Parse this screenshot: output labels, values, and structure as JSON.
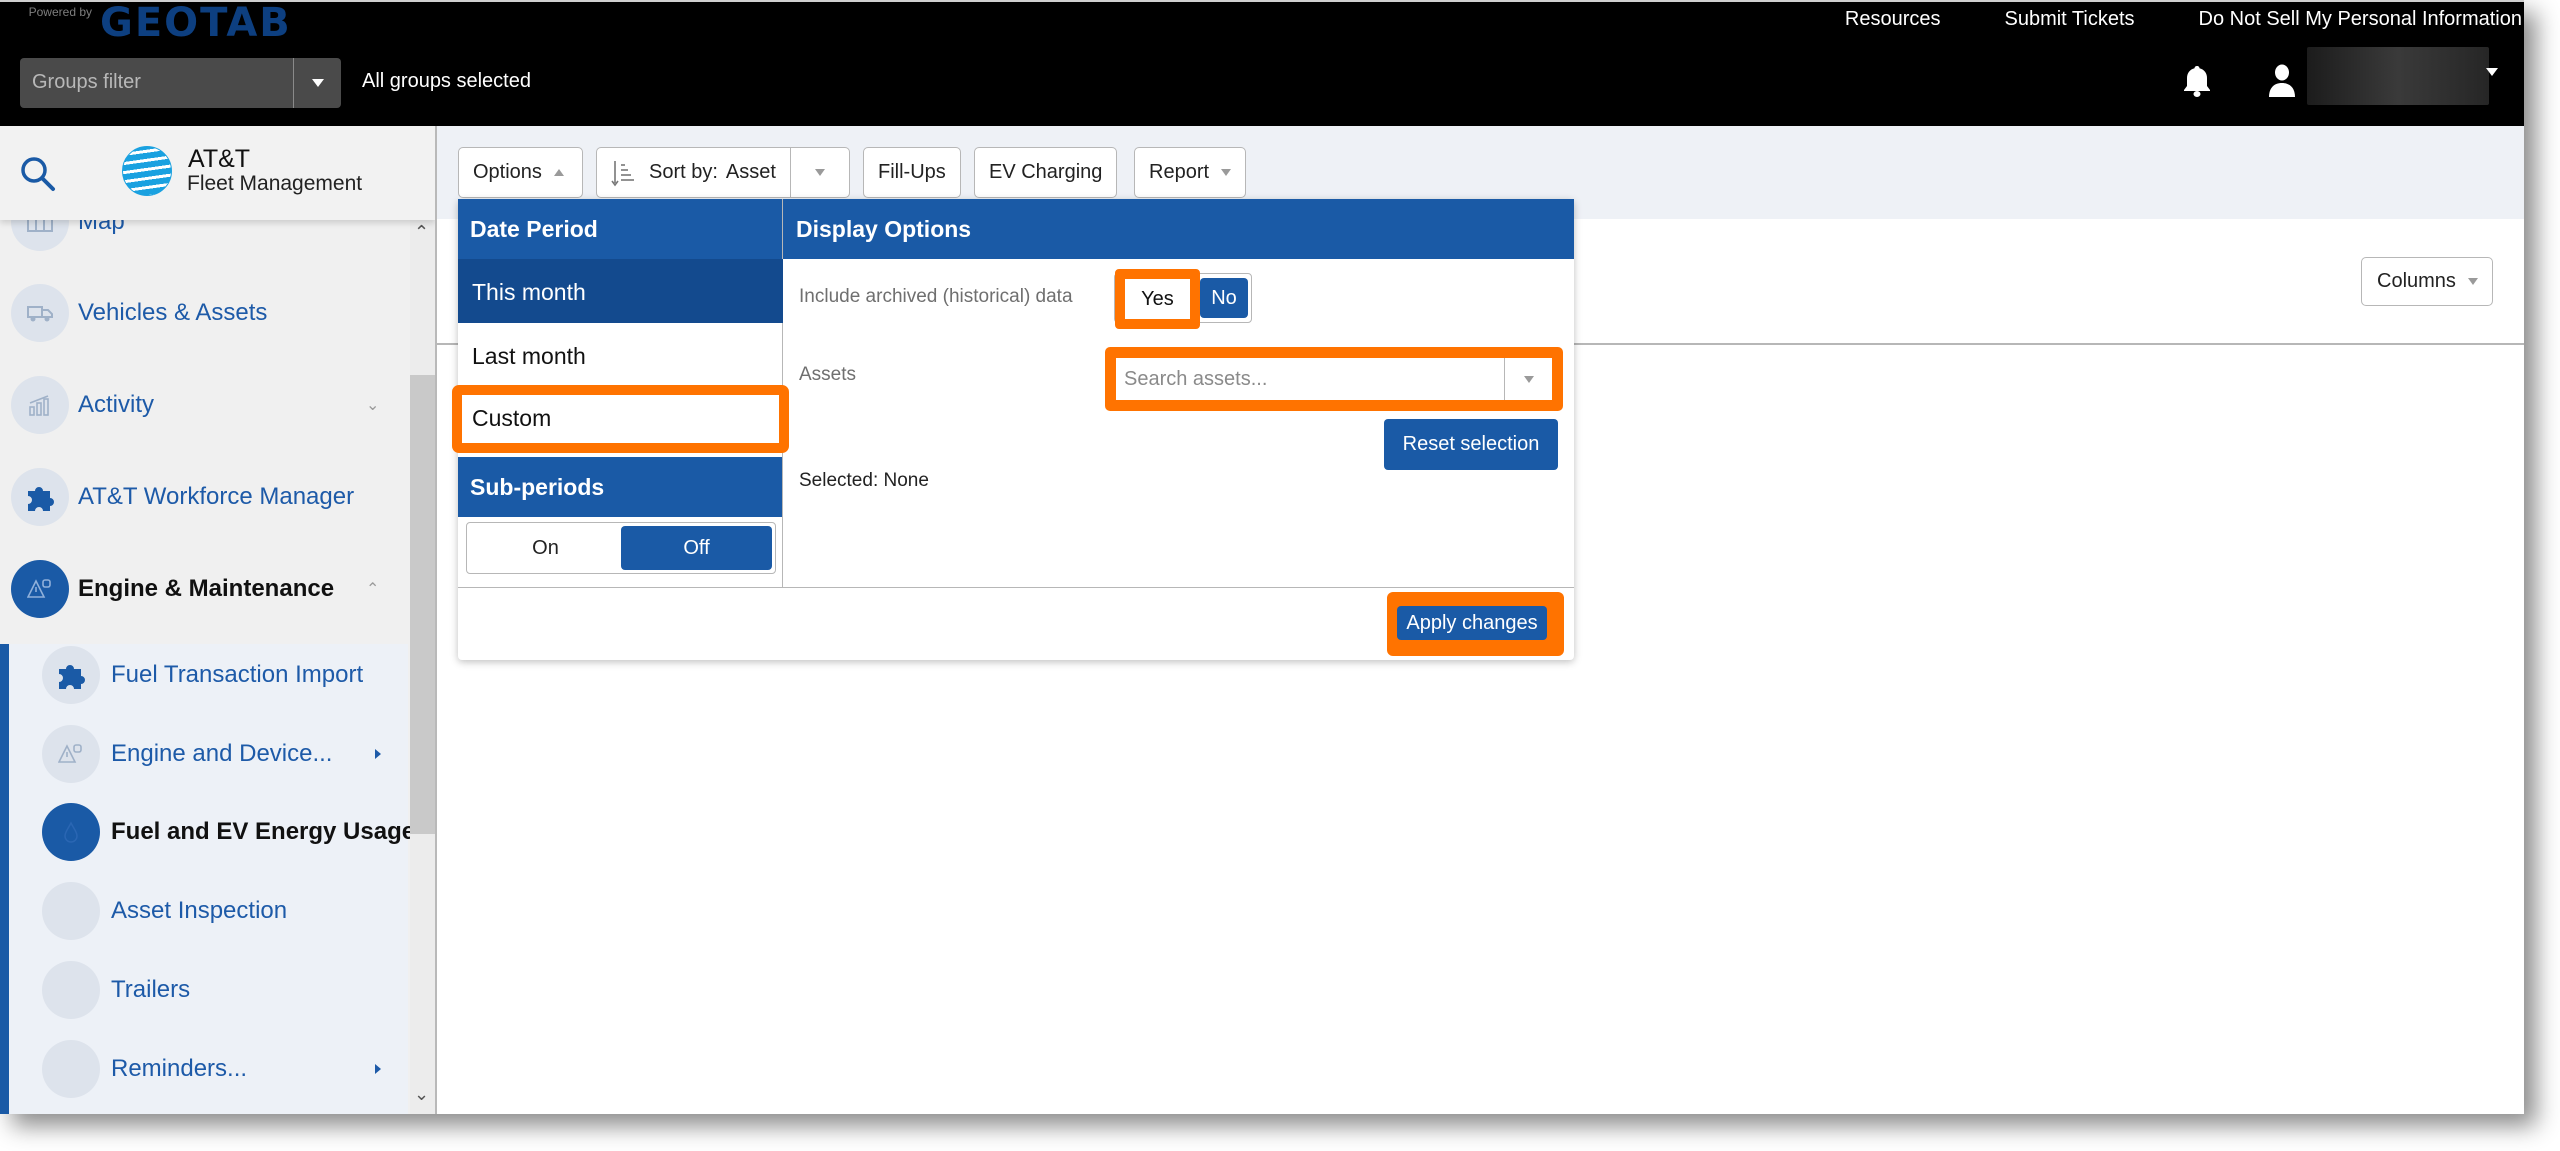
{
  "header": {
    "powered_by": "Powered by",
    "brand": "GEOTAB",
    "groups_filter": {
      "placeholder": "Groups filter",
      "status": "All groups selected"
    },
    "links": [
      "Resources",
      "Submit Tickets",
      "Do Not Sell My Personal Information"
    ],
    "icons": {
      "notifications": "bell-icon",
      "user": "user-icon"
    },
    "user_name": "(redacted)"
  },
  "sidebar": {
    "logo": {
      "name": "AT&T",
      "subtitle": "Fleet Management"
    },
    "items": [
      {
        "label": "Map",
        "icon": "map-icon",
        "level": 1
      },
      {
        "label": "Vehicles & Assets",
        "icon": "truck-icon",
        "level": 1
      },
      {
        "label": "Activity",
        "icon": "chart-icon",
        "level": 1,
        "expandable": true,
        "expanded": false
      },
      {
        "label": "AT&T Workforce Manager",
        "icon": "puzzle-icon",
        "level": 1
      },
      {
        "label": "Engine & Maintenance",
        "icon": "engine-warning-icon",
        "level": 1,
        "expandable": true,
        "expanded": true,
        "active": true
      },
      {
        "label": "Fuel Transaction Import",
        "icon": "puzzle-icon",
        "level": 2
      },
      {
        "label": "Engine and Device...",
        "icon": "engine-warning-icon",
        "level": 2,
        "has_submenu": true
      },
      {
        "label": "Fuel and EV Energy Usage",
        "icon": "fuel-drop-icon",
        "level": 2,
        "active": true
      },
      {
        "label": "Asset Inspection",
        "icon": "",
        "level": 2
      },
      {
        "label": "Trailers",
        "icon": "",
        "level": 2
      },
      {
        "label": "Reminders...",
        "icon": "",
        "level": 2,
        "has_submenu": true
      }
    ]
  },
  "toolbar": {
    "options": "Options",
    "sort_label": "Sort by:",
    "sort_value": "Asset",
    "fill_ups": "Fill-Ups",
    "ev_charging": "EV Charging",
    "report": "Report",
    "columns": "Columns"
  },
  "options_panel": {
    "date_period": {
      "title": "Date Period",
      "items": [
        "This month",
        "Last month",
        "Custom"
      ],
      "selected": "This month",
      "highlighted": "Custom"
    },
    "sub_periods": {
      "title": "Sub-periods",
      "on": "On",
      "off": "Off",
      "value": "Off"
    },
    "display_options": {
      "title": "Display Options",
      "archived_label": "Include archived (historical) data",
      "yes": "Yes",
      "no": "No",
      "archived_value": "No",
      "assets_label": "Assets",
      "assets_placeholder": "Search assets...",
      "reset": "Reset selection",
      "selected_text": "Selected: None"
    },
    "apply": "Apply changes"
  },
  "colors": {
    "primary": "#1a5aa6",
    "primary_dark": "#134a8e",
    "highlight": "#ff7300",
    "header_bg": "#000000"
  }
}
